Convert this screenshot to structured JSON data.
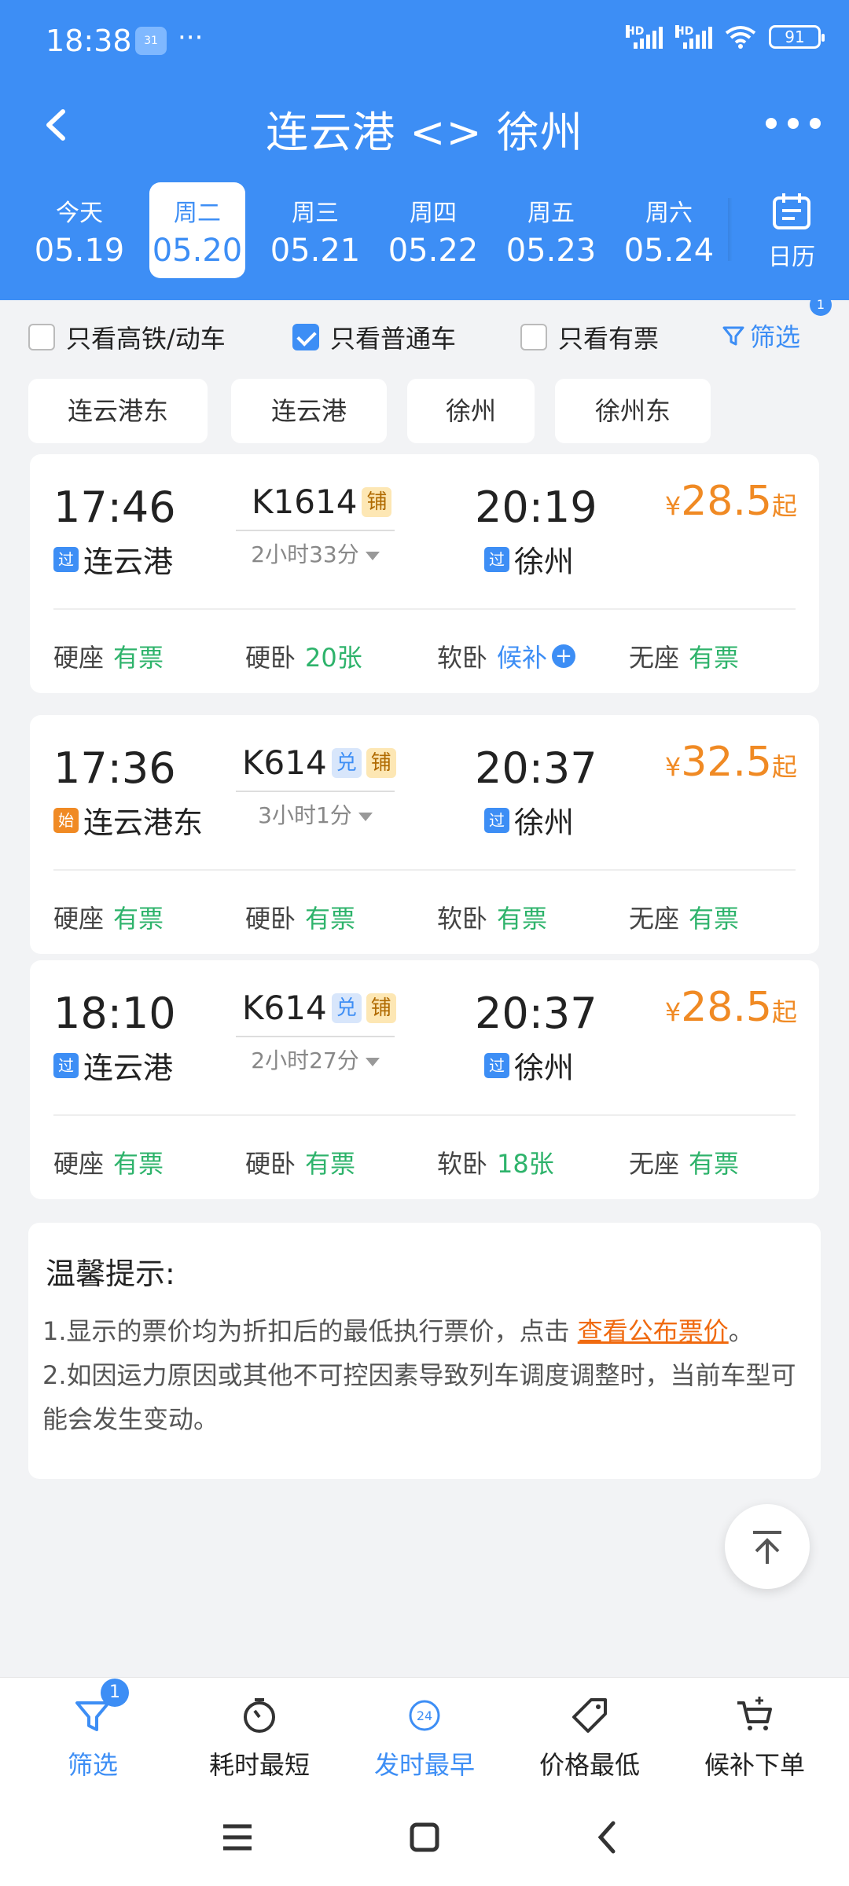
{
  "status_bar": {
    "time": "18:38",
    "weather_badge": "31",
    "more": "···",
    "signal_labels": [
      "HD",
      "HD"
    ],
    "battery": "91"
  },
  "title_bar": {
    "title": "连云港 <> 徐州",
    "back_icon": "chevron-left",
    "more_icon": "more-dots"
  },
  "dates": [
    {
      "weekday": "今天",
      "date": "05.19",
      "active": false
    },
    {
      "weekday": "周二",
      "date": "05.20",
      "active": true
    },
    {
      "weekday": "周三",
      "date": "05.21",
      "active": false
    },
    {
      "weekday": "周四",
      "date": "05.22",
      "active": false
    },
    {
      "weekday": "周五",
      "date": "05.23",
      "active": false
    },
    {
      "weekday": "周六",
      "date": "05.24",
      "active": false
    }
  ],
  "calendar_label": "日历",
  "filters": {
    "gaotie": {
      "label": "只看高铁/动车",
      "checked": false
    },
    "putong": {
      "label": "只看普通车",
      "checked": true
    },
    "youpiao": {
      "label": "只看有票",
      "checked": false
    },
    "filter_label": "筛选",
    "filter_badge": "1"
  },
  "stations": [
    "连云港东",
    "连云港",
    "徐州",
    "徐州东"
  ],
  "trains": [
    {
      "dep_time": "17:46",
      "dep_station": "连云港",
      "dep_badge": "过",
      "train_no": "K1614",
      "tags": [
        "铺"
      ],
      "duration": "2小时33分",
      "arr_time": "20:19",
      "arr_station": "徐州",
      "arr_badge": "过",
      "price_symbol": "¥",
      "price": "28.5",
      "price_suffix": "起",
      "seats": [
        {
          "name": "硬座",
          "value": "有票"
        },
        {
          "name": "硬卧",
          "value": "20张"
        },
        {
          "name": "软卧",
          "value": "候补"
        },
        {
          "name": "无座",
          "value": "有票"
        }
      ]
    },
    {
      "dep_time": "17:36",
      "dep_station": "连云港东",
      "dep_badge": "始",
      "train_no": "K614",
      "tags": [
        "兑",
        "铺"
      ],
      "duration": "3小时1分",
      "arr_time": "20:37",
      "arr_station": "徐州",
      "arr_badge": "过",
      "price_symbol": "¥",
      "price": "32.5",
      "price_suffix": "起",
      "seats": [
        {
          "name": "硬座",
          "value": "有票"
        },
        {
          "name": "硬卧",
          "value": "有票"
        },
        {
          "name": "软卧",
          "value": "有票"
        },
        {
          "name": "无座",
          "value": "有票"
        }
      ]
    },
    {
      "dep_time": "18:10",
      "dep_station": "连云港",
      "dep_badge": "过",
      "train_no": "K614",
      "tags": [
        "兑",
        "铺"
      ],
      "duration": "2小时27分",
      "arr_time": "20:37",
      "arr_station": "徐州",
      "arr_badge": "过",
      "price_symbol": "¥",
      "price": "28.5",
      "price_suffix": "起",
      "seats": [
        {
          "name": "硬座",
          "value": "有票"
        },
        {
          "name": "硬卧",
          "value": "有票"
        },
        {
          "name": "软卧",
          "value": "18张"
        },
        {
          "name": "无座",
          "value": "有票"
        }
      ]
    }
  ],
  "tips": {
    "title": "温馨提示:",
    "line1_prefix": "1.显示的票价均为折扣后的最低执行票价，点击 ",
    "line1_link": "查看公布票价",
    "line1_suffix": "。",
    "line2": "2.如因运力原因或其他不可控因素导致列车调度调整时，当前车型可能会发生变动。"
  },
  "bottom_nav": [
    {
      "label": "筛选",
      "icon": "filter-icon",
      "active": true,
      "badge": "1"
    },
    {
      "label": "耗时最短",
      "icon": "timer-icon",
      "active": false
    },
    {
      "label": "发时最早",
      "icon": "clock-24-icon",
      "active": true
    },
    {
      "label": "价格最低",
      "icon": "price-tag-icon",
      "active": false
    },
    {
      "label": "候补下单",
      "icon": "cart-icon",
      "active": false
    }
  ],
  "colors": {
    "primary": "#3d8ef5",
    "price": "#f08a24",
    "available": "#2eb36b",
    "link": "#f06a10"
  }
}
